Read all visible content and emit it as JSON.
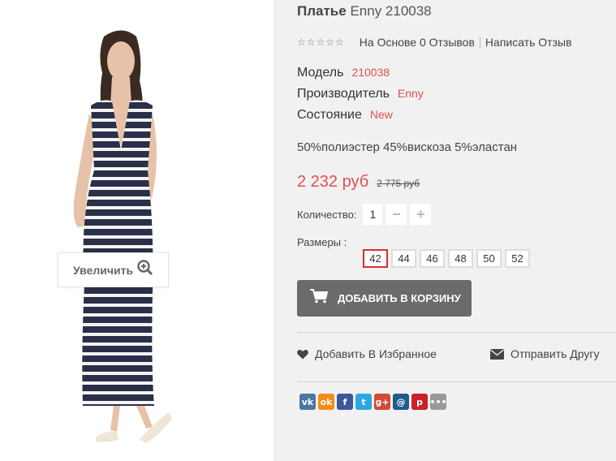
{
  "product": {
    "title_bold": "Платье",
    "title_rest": " Enny 210038"
  },
  "rating": {
    "stars": "☆☆☆☆☆",
    "reviews_link": "На Основе 0 Отзывов",
    "write_link": "Написать Отзыв"
  },
  "specs": {
    "model_label": "Модель",
    "model_value": "210038",
    "maker_label": "Производитель",
    "maker_value": "Enny",
    "condition_label": "Состояние",
    "condition_value": "New"
  },
  "description": "50%полиэстер 45%вискоза 5%эластан",
  "price": {
    "current": "2 232 руб",
    "old": "2 775 руб"
  },
  "quantity": {
    "label": "Количество:",
    "value": "1",
    "minus": "−",
    "plus": "+"
  },
  "sizes": {
    "label": "Размеры :",
    "options": [
      "42",
      "44",
      "46",
      "48",
      "50",
      "52"
    ],
    "selected": "42"
  },
  "cart_button": "Добавить в корзину",
  "actions": {
    "wishlist": "Добавить В Избранное",
    "send_friend": "Отправить Другу"
  },
  "zoom_label": "Увеличить",
  "share_icons": [
    {
      "name": "vk",
      "glyph": "vk",
      "color": "#4c75a3"
    },
    {
      "name": "odnoklassniki",
      "glyph": "ok",
      "color": "#f28c1b"
    },
    {
      "name": "facebook",
      "glyph": "f",
      "color": "#3b5998"
    },
    {
      "name": "twitter",
      "glyph": "t",
      "color": "#2ca7e0"
    },
    {
      "name": "google-plus",
      "glyph": "g+",
      "color": "#d34836"
    },
    {
      "name": "email",
      "glyph": "@",
      "color": "#1e5d8c"
    },
    {
      "name": "pinterest",
      "glyph": "p",
      "color": "#cb2027"
    },
    {
      "name": "more",
      "glyph": "•••",
      "color": "#999999"
    }
  ],
  "colors": {
    "accent": "#e05050",
    "selected_size_border": "#d32f2f",
    "cart_button_bg": "#6b6b6b",
    "panel_bg": "#f1f1f1"
  }
}
